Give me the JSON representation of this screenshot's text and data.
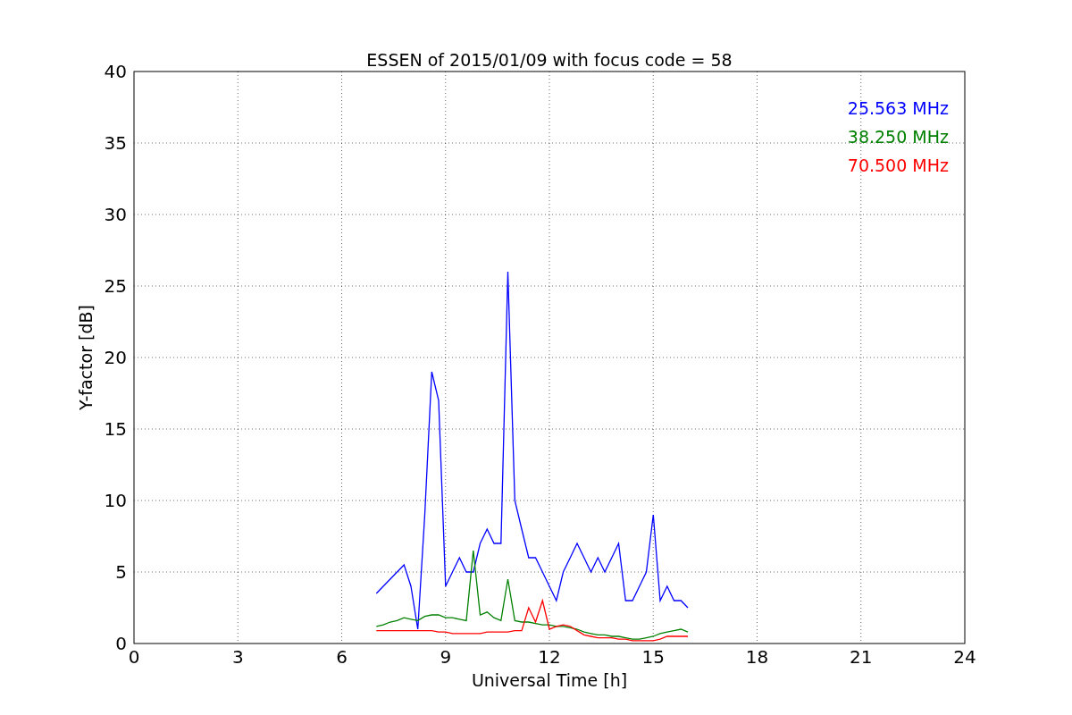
{
  "chart_data": {
    "type": "line",
    "title": "ESSEN of 2015/01/09 with focus code = 58",
    "xlabel": "Universal Time [h]",
    "ylabel": "Y-factor [dB]",
    "x": [
      7.0,
      7.2,
      7.4,
      7.6,
      7.8,
      8.0,
      8.2,
      8.4,
      8.6,
      8.8,
      9.0,
      9.2,
      9.4,
      9.6,
      9.8,
      10.0,
      10.2,
      10.4,
      10.6,
      10.8,
      11.0,
      11.2,
      11.4,
      11.6,
      11.8,
      12.0,
      12.2,
      12.4,
      12.6,
      12.8,
      13.0,
      13.2,
      13.4,
      13.6,
      13.8,
      14.0,
      14.2,
      14.4,
      14.6,
      14.8,
      15.0,
      15.2,
      15.4,
      15.6,
      15.8,
      16.0
    ],
    "series": [
      {
        "name": "25.563 MHz",
        "color": "#0000ff",
        "values": [
          3.5,
          4,
          4.5,
          5,
          5.5,
          4,
          1,
          9,
          19,
          17,
          4,
          5,
          6,
          5,
          5,
          7,
          8,
          7,
          7,
          26,
          10,
          8,
          6,
          6,
          5,
          4,
          3,
          5,
          6,
          7,
          6,
          5,
          6,
          5,
          6,
          7,
          3,
          3,
          4,
          5,
          9,
          3,
          4,
          3,
          3,
          2.5
        ]
      },
      {
        "name": "38.250 MHz",
        "color": "#008000",
        "values": [
          1.2,
          1.3,
          1.5,
          1.6,
          1.8,
          1.7,
          1.6,
          1.9,
          2,
          2,
          1.8,
          1.8,
          1.7,
          1.6,
          6.5,
          2,
          2.2,
          1.8,
          1.6,
          4.5,
          1.6,
          1.5,
          1.5,
          1.4,
          1.3,
          1.3,
          1.2,
          1.2,
          1.1,
          1,
          0.8,
          0.7,
          0.6,
          0.6,
          0.5,
          0.5,
          0.4,
          0.3,
          0.3,
          0.4,
          0.5,
          0.7,
          0.8,
          0.9,
          1,
          0.8
        ]
      },
      {
        "name": "70.500 MHz",
        "color": "#ff0000",
        "values": [
          0.9,
          0.9,
          0.9,
          0.9,
          0.9,
          0.9,
          0.9,
          0.9,
          0.9,
          0.8,
          0.8,
          0.7,
          0.7,
          0.7,
          0.7,
          0.7,
          0.8,
          0.8,
          0.8,
          0.8,
          0.9,
          0.9,
          2.5,
          1.5,
          3,
          1,
          1.2,
          1.3,
          1.2,
          0.9,
          0.6,
          0.5,
          0.4,
          0.4,
          0.4,
          0.3,
          0.3,
          0.2,
          0.2,
          0.2,
          0.2,
          0.3,
          0.5,
          0.5,
          0.5,
          0.5
        ]
      }
    ],
    "grid": true,
    "xlim": [
      0,
      24
    ],
    "ylim": [
      0,
      40
    ],
    "xticks": [
      0,
      3,
      6,
      9,
      12,
      15,
      18,
      21,
      24
    ],
    "yticks": [
      0,
      5,
      10,
      15,
      20,
      25,
      30,
      35,
      40
    ]
  }
}
